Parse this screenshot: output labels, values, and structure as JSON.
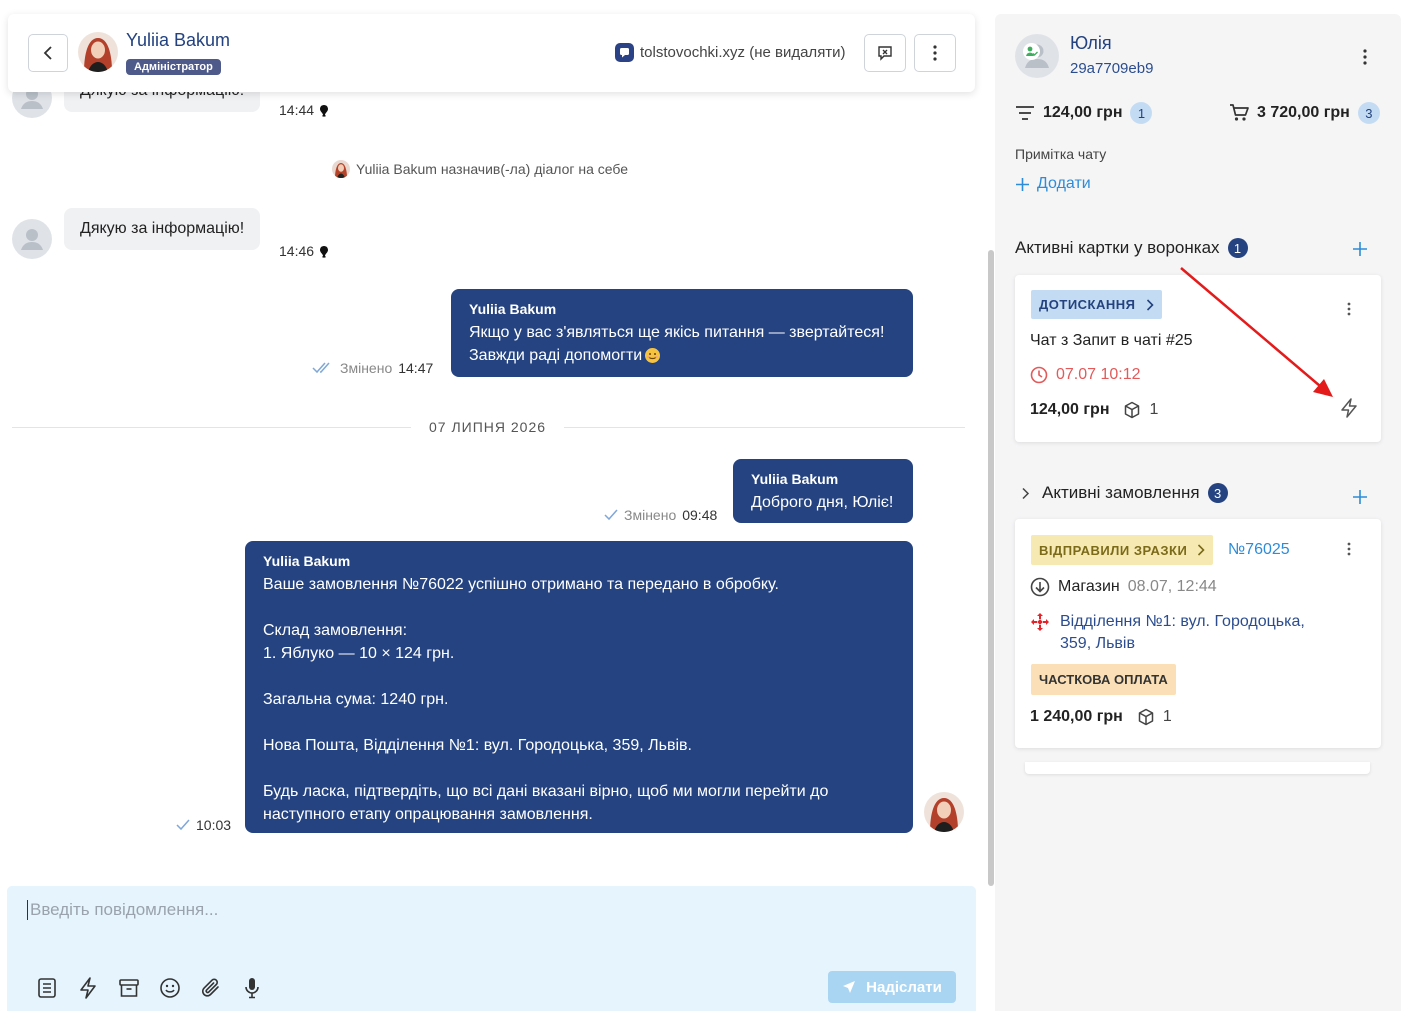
{
  "header": {
    "name": "Yuliia Bakum",
    "role": "Адміністратор",
    "source": "tolstovochki.xyz (не видаляти)"
  },
  "messages": {
    "partial_text": "Дякую за інформацію!",
    "partial_time": "14:44",
    "system_text": "Yuliia Bakum назначив(-ла) діалог на себе",
    "in_text": "Дякую за інформацію!",
    "in_time": "14:46",
    "out1": {
      "sender": "Yuliia Bakum",
      "line1": "Якщо у вас з'являться ще якісь питання — звертайтеся!",
      "line2": "Завжди раді допомогти",
      "status": "Змінено",
      "time": "14:47"
    },
    "date_separator": "07 ЛИПНЯ 2026",
    "out2": {
      "sender": "Yuliia Bakum",
      "text": "Доброго дня, Юліє!",
      "status": "Змінено",
      "time": "09:48"
    },
    "out3": {
      "sender": "Yuliia Bakum",
      "lines": [
        "Ваше замовлення №76022 успішно отримано та передано в обробку.",
        "",
        "Склад замовлення:",
        "1. Яблуко — 10 × 124 грн.",
        "",
        "Загальна сума: 1240 грн.",
        "",
        "Нова Пошта, Відділення №1: вул. Городоцька, 359, Львів.",
        "",
        "Будь ласка, підтвердіть, що всі дані вказані вірно, щоб ми могли перейти до",
        "наступного етапу опрацювання замовлення."
      ],
      "time": "10:03"
    }
  },
  "composer": {
    "placeholder": "Введіть повідомлення...",
    "send_label": "Надіслати"
  },
  "client": {
    "name": "Юлія",
    "id": "29a7709eb9",
    "stat_filter_amount": "124,00 грн",
    "stat_filter_count": "1",
    "stat_cart_amount": "3 720,00 грн",
    "stat_cart_count": "3",
    "note_label": "Примітка чату",
    "note_add": "Додати"
  },
  "funnels": {
    "title": "Активні картки у воронках",
    "count": "1",
    "card": {
      "stage": "ДОТИСКАННЯ",
      "title": "Чат з Запит в чаті #25",
      "deadline": "07.07 10:12",
      "amount": "124,00 грн",
      "items": "1"
    }
  },
  "orders": {
    "title": "Активні замовлення",
    "count": "3",
    "card": {
      "stage": "ВІДПРАВИЛИ ЗРАЗКИ",
      "number": "№76025",
      "store": "Магазин",
      "store_date": "08.07, 12:44",
      "delivery_line1": "Відділення №1: вул. Городоцька,",
      "delivery_line2": "359, Львів",
      "payment": "ЧАСТКОВА ОПЛАТА",
      "amount": "1 240,00 грн",
      "items": "1"
    }
  },
  "colors": {
    "brand": "#244380",
    "accent": "#2d8cd8",
    "funnel_chip": "#c4dcf3",
    "order_chip": "#f6eab2",
    "payment_chip": "#fbe0b7",
    "deadline": "#e25a5a",
    "arrow": "#e31b1b"
  }
}
